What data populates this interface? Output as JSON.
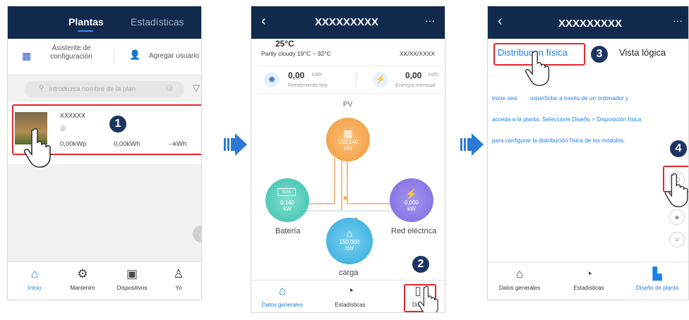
{
  "screen1": {
    "tabs": [
      "Plantas",
      "Estadísticas"
    ],
    "wizard_label": "Asistente de configuración",
    "add_user_label": "Agregar usuario",
    "search_placeholder": "Introduzca nombre de la plan",
    "plant": {
      "name": "XXXXXX",
      "capacity": "0,00kWp",
      "energy": "0,00kWh",
      "third": "--kWh"
    },
    "nav": [
      "Inicio",
      "Mantenim",
      "Dispositivos",
      "Yo"
    ]
  },
  "screen2": {
    "title": "XXXXXXXXX",
    "menu": "···",
    "temperature": "25°C",
    "weather": "Partly cloudy 19°C ~ 32°C",
    "date": "XX/XX/XXXX",
    "daily_value": "0,00",
    "daily_unit": "kWh",
    "daily_label": "Rendimiento hoy",
    "monthly_value": "0,00",
    "monthly_unit": "kWh",
    "monthly_label": "Energía mensual",
    "pv_label": "PV",
    "pv_value": "150,140",
    "pv_unit": "kW",
    "battery_label": "Batería",
    "battery_soc": "50%",
    "battery_value": "0,140",
    "battery_unit": "kW",
    "grid_label": "Red eléctrica",
    "grid_value": "0,000",
    "grid_unit": "kW",
    "load_label": "carga",
    "load_value": "150,000",
    "load_unit": "kW",
    "nav": [
      "Datos generales",
      "Estadísticas",
      "Dise"
    ]
  },
  "screen3": {
    "title": "XXXXXXXXX",
    "menu": "···",
    "tab_physical": "Distribuc  n física",
    "tab_logical": "Vista lógica",
    "info_line1": "Inicie sesi        usionSolar a través de un ordenador y",
    "info_line2": "acceda a la planta. Seleccione Diseño > Disposición física",
    "info_line3": "para configurar la distribución física de los módulos.",
    "nav": [
      "Datos generales",
      "Estadísticas",
      "Diseño de planta"
    ]
  },
  "steps": [
    "1",
    "2",
    "3",
    "4"
  ],
  "colors": {
    "header": "#12294e",
    "accent": "#1a7fe6",
    "highlight": "#e5262d",
    "badge": "#1c3560",
    "pv": "#f6a64e",
    "battery": "#49c9b8",
    "grid": "#8a78e6",
    "load": "#3cb3e3"
  },
  "icons": {
    "back": "chevron-left-icon",
    "flow_arrow": "arrow-right-icon",
    "hand": "hand-pointer-icon"
  }
}
